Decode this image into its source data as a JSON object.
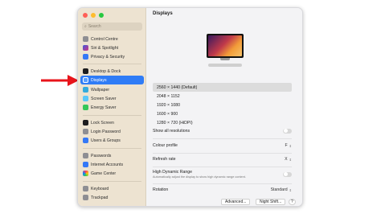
{
  "window": {
    "title": "Displays",
    "search_placeholder": "Search"
  },
  "sidebar": {
    "items": [
      {
        "label": "Control Centre",
        "icon": "control-centre-icon",
        "color": "#8e8e93"
      },
      {
        "label": "Siri & Spotlight",
        "icon": "siri-icon",
        "color": "#c04ad8"
      },
      {
        "label": "Privacy & Security",
        "icon": "hand-icon",
        "color": "#3478f6"
      },
      {
        "label": "Desktop & Dock",
        "icon": "dock-icon",
        "color": "#1c1c1e"
      },
      {
        "label": "Displays",
        "icon": "display-icon",
        "color": "#3478f6"
      },
      {
        "label": "Wallpaper",
        "icon": "wallpaper-icon",
        "color": "#34aadc"
      },
      {
        "label": "Screen Saver",
        "icon": "screen-saver-icon",
        "color": "#5ac8fa"
      },
      {
        "label": "Energy Saver",
        "icon": "energy-icon",
        "color": "#34c759"
      },
      {
        "label": "Lock Screen",
        "icon": "lock-icon",
        "color": "#1c1c1e"
      },
      {
        "label": "Login Password",
        "icon": "key-icon",
        "color": "#8e8e93"
      },
      {
        "label": "Users & Groups",
        "icon": "users-icon",
        "color": "#3478f6"
      },
      {
        "label": "Passwords",
        "icon": "password-icon",
        "color": "#8e8e93"
      },
      {
        "label": "Internet Accounts",
        "icon": "at-icon",
        "color": "#3478f6"
      },
      {
        "label": "Game Center",
        "icon": "game-center-icon",
        "color": "#f2f2f2"
      },
      {
        "label": "Keyboard",
        "icon": "keyboard-icon",
        "color": "#8e8e93"
      },
      {
        "label": "Trackpad",
        "icon": "trackpad-icon",
        "color": "#8e8e93"
      }
    ],
    "selected_label": "Displays"
  },
  "resolutions": [
    "2560 × 1440 (Default)",
    "2048 × 1152",
    "1920 × 1080",
    "1600 × 900",
    "1280 × 720 (HiDPI)"
  ],
  "settings": {
    "show_all_resolutions": "Show all resolutions",
    "colour_profile_label": "Colour profile",
    "colour_profile_value": "F",
    "refresh_rate_label": "Refresh rate",
    "refresh_rate_value": "X",
    "hdr_label": "High Dynamic Range",
    "hdr_desc": "Automatically adjust the display to show high dynamic range content.",
    "rotation_label": "Rotation",
    "rotation_value": "Standard"
  },
  "buttons": {
    "advanced": "Advanced...",
    "night_shift": "Night Shift...",
    "help": "?"
  },
  "colors": {
    "accent": "#2f7cf6",
    "arrow": "#e8141b"
  }
}
